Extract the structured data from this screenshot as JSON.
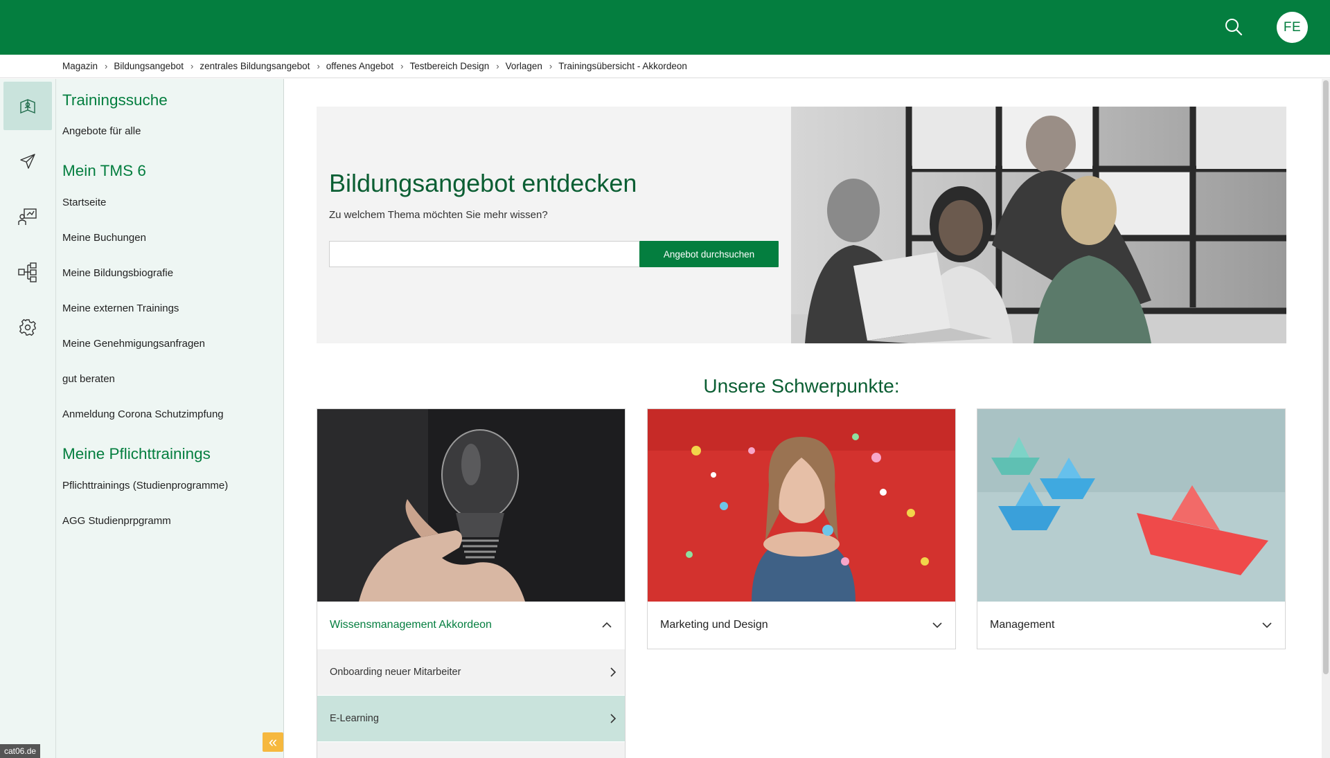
{
  "topbar": {
    "avatar_initials": "FE",
    "search_icon": "search-icon",
    "brand_color": "#047e3f"
  },
  "breadcrumb": [
    "Magazin",
    "Bildungsangebot",
    "zentrales Bildungsangebot",
    "offenes Angebot",
    "Testbereich Design",
    "Vorlagen",
    "Trainingsübersicht - Akkordeon"
  ],
  "rail": {
    "items": [
      {
        "icon": "book-icon",
        "active": true
      },
      {
        "icon": "send-icon",
        "active": false
      },
      {
        "icon": "trainer-board-icon",
        "active": false
      },
      {
        "icon": "hierarchy-icon",
        "active": false
      },
      {
        "icon": "gear-icon",
        "active": false
      }
    ]
  },
  "sidebar": {
    "sections": [
      {
        "title": "Trainingssuche",
        "links": [
          "Angebote für alle"
        ]
      },
      {
        "title": "Mein TMS 6",
        "links": [
          "Startseite",
          "Meine Buchungen",
          "Meine Bildungsbiografie",
          "Meine externen Trainings",
          "Meine Genehmigungsanfragen",
          "gut beraten",
          "Anmeldung Corona Schutzimpfung"
        ]
      },
      {
        "title": "Meine Pflichttrainings",
        "links": [
          "Pflichttrainings (Studienprogramme)",
          "AGG Studienprpgramm"
        ]
      }
    ],
    "collapse_icon": "double-chevron-left-icon",
    "host_label": "cat06.de"
  },
  "hero": {
    "title": "Bildungsangebot entdecken",
    "subtitle": "Zu welchem Thema möchten Sie mehr wissen?",
    "search_value": "",
    "search_button": "Angebot durchsuchen"
  },
  "focus": {
    "heading": "Unsere Schwerpunkte:",
    "cards": [
      {
        "title": "Wissensmanagement Akkordeon",
        "expanded": true,
        "image": "lightbulb-photo",
        "items": [
          {
            "label": "Onboarding neuer Mitarbeiter",
            "highlight": false
          },
          {
            "label": "E-Learning",
            "highlight": true
          }
        ]
      },
      {
        "title": "Marketing und Design",
        "expanded": false,
        "image": "confetti-photo",
        "items": []
      },
      {
        "title": "Management",
        "expanded": false,
        "image": "paper-boats-photo",
        "items": []
      }
    ]
  },
  "colors": {
    "accent": "#047e3f",
    "heading_green": "#0b5e33",
    "sidebar_bg": "#eef6f3",
    "highlight_row": "#c9e3dc",
    "collapse_button": "#f6b83e"
  }
}
